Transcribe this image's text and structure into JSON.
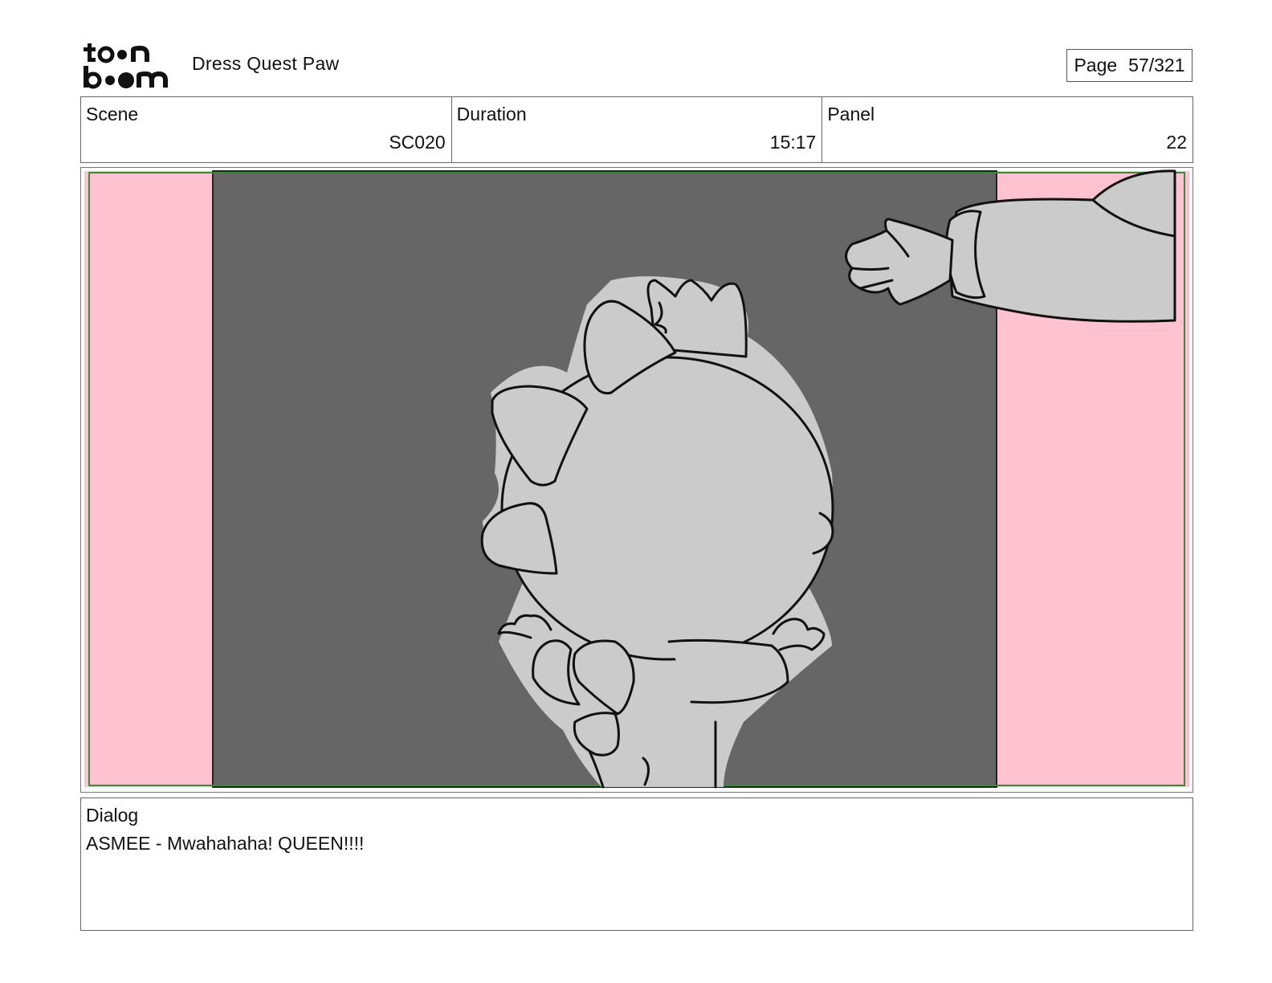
{
  "header": {
    "logo_text": "toon boom",
    "project_title": "Dress Quest Paw",
    "page_label": "Page",
    "page_value": "57/321"
  },
  "info": {
    "scene_label": "Scene",
    "scene_value": "SC020",
    "duration_label": "Duration",
    "duration_value": "15:17",
    "panel_label": "Panel",
    "panel_value": "22"
  },
  "panel": {
    "background_color": "#666666",
    "bleed_color": "#ffc2d0",
    "safe_frame_color": "#3a8a3a",
    "character_fill": "#cbcbcb"
  },
  "dialog": {
    "label": "Dialog",
    "text": "ASMEE - Mwahahaha! QUEEN!!!!"
  }
}
